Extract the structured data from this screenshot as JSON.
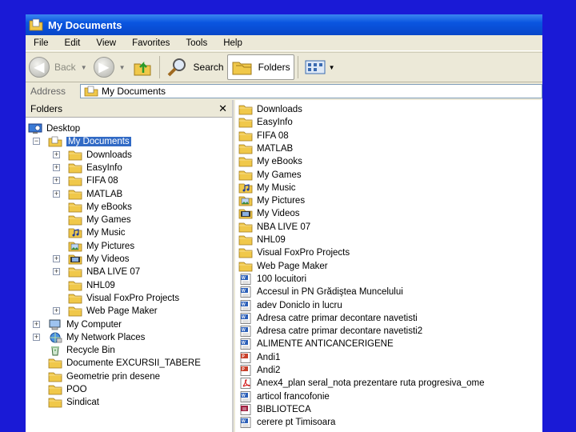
{
  "window": {
    "title": "My Documents"
  },
  "menu": [
    "File",
    "Edit",
    "View",
    "Favorites",
    "Tools",
    "Help"
  ],
  "toolbar": {
    "back": "Back",
    "search": "Search",
    "folders": "Folders"
  },
  "address": {
    "label": "Address",
    "value": "My Documents"
  },
  "folders_pane": {
    "title": "Folders",
    "close": "✕",
    "tree": [
      {
        "label": "Desktop",
        "icon": "desktop-icon",
        "level": 0,
        "expander": ""
      },
      {
        "label": "My Documents",
        "icon": "my-documents-icon",
        "level": 1,
        "expander": "−",
        "selected": true
      },
      {
        "label": "Downloads",
        "icon": "folder-icon",
        "level": 2,
        "expander": "+"
      },
      {
        "label": "EasyInfo",
        "icon": "folder-icon",
        "level": 2,
        "expander": "+"
      },
      {
        "label": "FIFA 08",
        "icon": "folder-icon",
        "level": 2,
        "expander": "+"
      },
      {
        "label": "MATLAB",
        "icon": "folder-icon",
        "level": 2,
        "expander": "+"
      },
      {
        "label": "My eBooks",
        "icon": "folder-icon",
        "level": 2,
        "expander": ""
      },
      {
        "label": "My Games",
        "icon": "folder-icon",
        "level": 2,
        "expander": ""
      },
      {
        "label": "My Music",
        "icon": "music-folder-icon",
        "level": 2,
        "expander": ""
      },
      {
        "label": "My Pictures",
        "icon": "pictures-folder-icon",
        "level": 2,
        "expander": ""
      },
      {
        "label": "My Videos",
        "icon": "videos-folder-icon",
        "level": 2,
        "expander": "+"
      },
      {
        "label": "NBA LIVE 07",
        "icon": "folder-icon",
        "level": 2,
        "expander": "+"
      },
      {
        "label": "NHL09",
        "icon": "folder-icon",
        "level": 2,
        "expander": ""
      },
      {
        "label": "Visual FoxPro Projects",
        "icon": "folder-icon",
        "level": 2,
        "expander": ""
      },
      {
        "label": "Web Page Maker",
        "icon": "folder-icon",
        "level": 2,
        "expander": "+"
      },
      {
        "label": "My Computer",
        "icon": "my-computer-icon",
        "level": 1,
        "expander": "+"
      },
      {
        "label": "My Network Places",
        "icon": "network-places-icon",
        "level": 1,
        "expander": "+"
      },
      {
        "label": "Recycle Bin",
        "icon": "recycle-bin-icon",
        "level": 1,
        "expander": ""
      },
      {
        "label": "Documente EXCURSII_TABERE",
        "icon": "folder-icon",
        "level": 1,
        "expander": ""
      },
      {
        "label": "Geometrie prin desene",
        "icon": "folder-icon",
        "level": 1,
        "expander": ""
      },
      {
        "label": "POO",
        "icon": "folder-icon",
        "level": 1,
        "expander": ""
      },
      {
        "label": "Sindicat",
        "icon": "folder-icon",
        "level": 1,
        "expander": ""
      }
    ]
  },
  "files": [
    {
      "name": "Downloads",
      "icon": "folder-icon"
    },
    {
      "name": "EasyInfo",
      "icon": "folder-icon"
    },
    {
      "name": "FIFA 08",
      "icon": "folder-icon"
    },
    {
      "name": "MATLAB",
      "icon": "folder-icon"
    },
    {
      "name": "My eBooks",
      "icon": "folder-icon"
    },
    {
      "name": "My Games",
      "icon": "folder-icon"
    },
    {
      "name": "My Music",
      "icon": "music-folder-icon"
    },
    {
      "name": "My Pictures",
      "icon": "pictures-folder-icon"
    },
    {
      "name": "My Videos",
      "icon": "videos-folder-icon"
    },
    {
      "name": "NBA LIVE 07",
      "icon": "folder-icon"
    },
    {
      "name": "NHL09",
      "icon": "folder-icon"
    },
    {
      "name": "Visual FoxPro Projects",
      "icon": "folder-icon"
    },
    {
      "name": "Web Page Maker",
      "icon": "folder-icon"
    },
    {
      "name": "100 locuitori",
      "icon": "word-doc-icon"
    },
    {
      "name": "Accesul in PN Grădiştea Muncelului",
      "icon": "word-doc-icon"
    },
    {
      "name": "adev Doniclo in lucru",
      "icon": "word-doc-icon"
    },
    {
      "name": "Adresa catre primar decontare navetisti",
      "icon": "word-doc-icon"
    },
    {
      "name": "Adresa catre primar decontare navetisti2",
      "icon": "word-doc-icon"
    },
    {
      "name": "ALIMENTE ANTICANCERIGENE",
      "icon": "word-doc-icon"
    },
    {
      "name": "Andi1",
      "icon": "powerpoint-icon"
    },
    {
      "name": "Andi2",
      "icon": "powerpoint-icon"
    },
    {
      "name": "Anex4_plan seral_nota prezentare ruta progresiva_ome",
      "icon": "pdf-icon"
    },
    {
      "name": "articol francofonie",
      "icon": "word-doc-icon"
    },
    {
      "name": "BIBLIOTECA",
      "icon": "access-db-icon"
    },
    {
      "name": "cerere pt Timisoara",
      "icon": "word-doc-icon"
    }
  ],
  "colors": {
    "background": "#1a1ad6",
    "titlebar": "#0a55e0",
    "selection": "#316ac5",
    "folder": "#f0c84a"
  }
}
